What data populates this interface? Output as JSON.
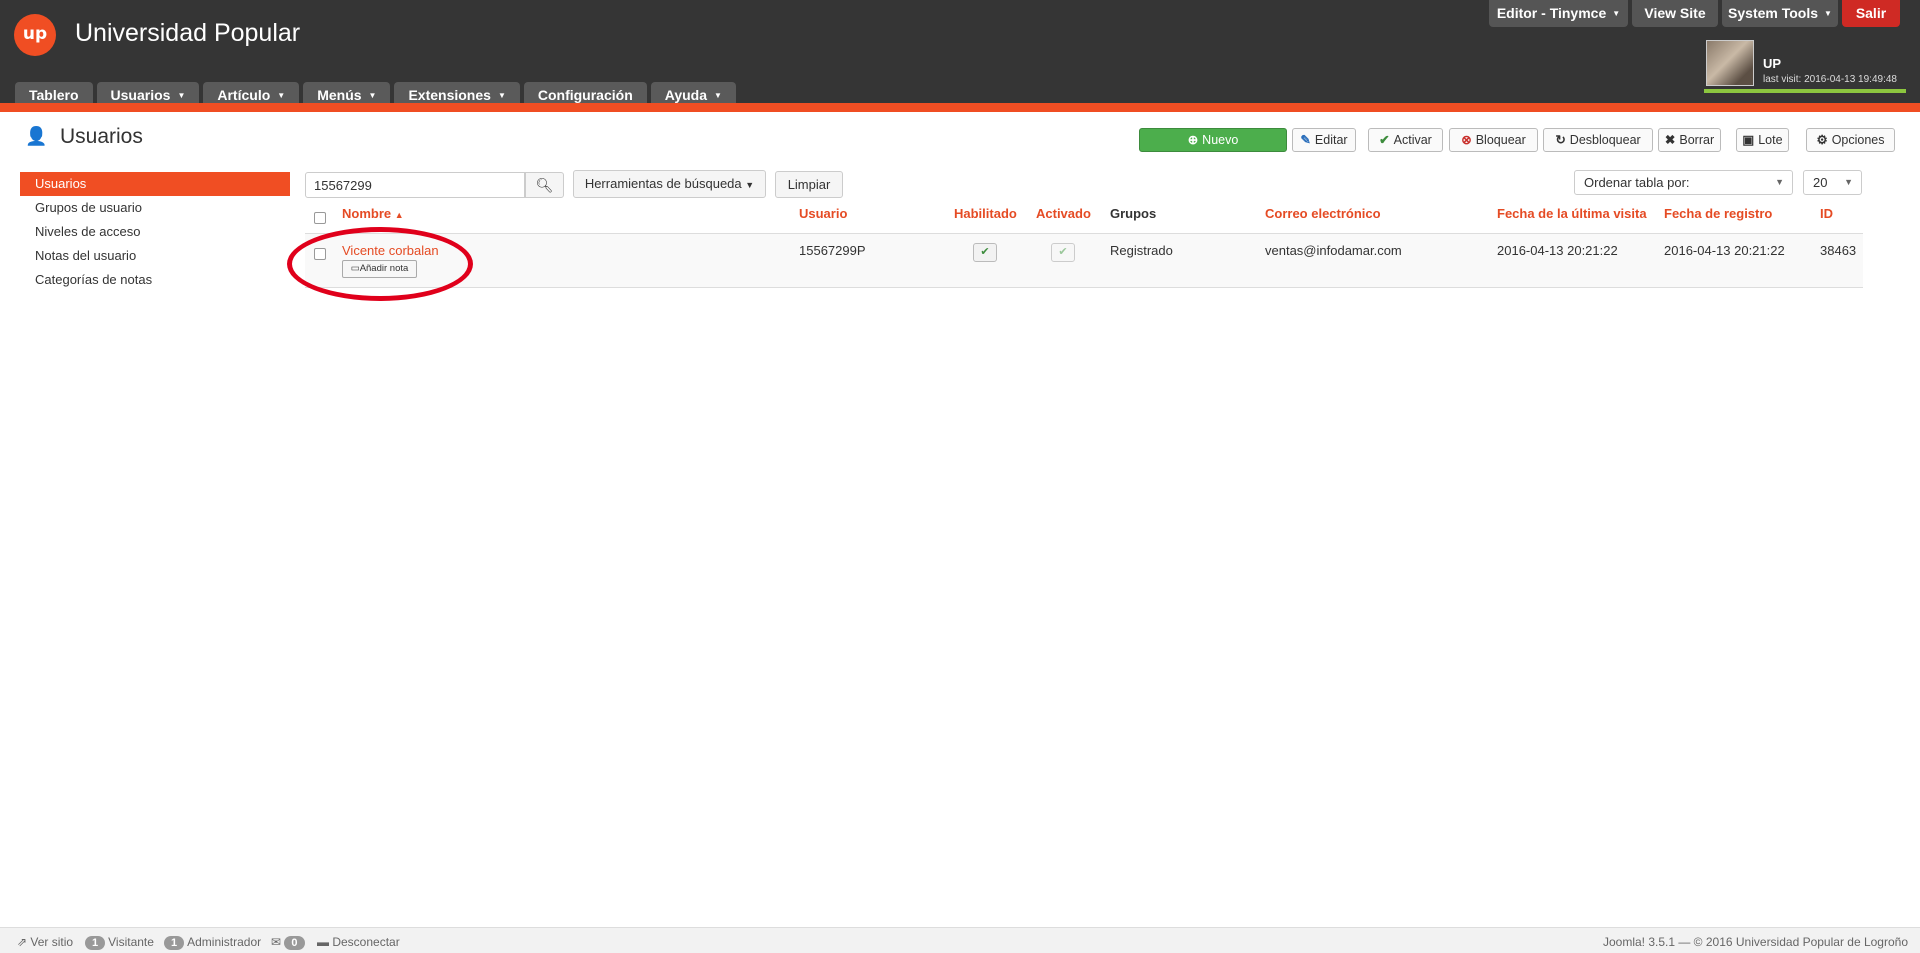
{
  "header": {
    "logo_text": "up",
    "site_title": "Universidad Popular",
    "top_buttons": {
      "editor": "Editor - Tinymce",
      "view_site": "View Site",
      "system_tools": "System Tools",
      "logout": "Salir"
    },
    "user": {
      "name": "UP",
      "last_visit": "last visit: 2016-04-13 19:49:48"
    },
    "accent_color": "#f04e23"
  },
  "nav": {
    "items": [
      {
        "label": "Tablero"
      },
      {
        "label": "Usuarios"
      },
      {
        "label": "Artículo"
      },
      {
        "label": "Menús"
      },
      {
        "label": "Extensiones"
      },
      {
        "label": "Configuración"
      },
      {
        "label": "Ayuda"
      }
    ]
  },
  "page": {
    "title": "Usuarios",
    "icon": "users-icon"
  },
  "toolbar": {
    "new": "Nuevo",
    "edit": "Editar",
    "activate": "Activar",
    "block": "Bloquear",
    "unblock": "Desbloquear",
    "delete": "Borrar",
    "batch": "Lote",
    "options": "Opciones"
  },
  "sidebar": {
    "items": [
      {
        "label": "Usuarios",
        "active": true
      },
      {
        "label": "Grupos de usuario"
      },
      {
        "label": "Niveles de acceso"
      },
      {
        "label": "Notas del usuario"
      },
      {
        "label": "Categorías de notas"
      }
    ]
  },
  "filters": {
    "search_value": "15567299",
    "search_tools": "Herramientas de búsqueda",
    "clear": "Limpiar",
    "order_by": "Ordenar tabla por:",
    "limit": "20"
  },
  "table": {
    "headers": {
      "name": "Nombre",
      "username": "Usuario",
      "enabled": "Habilitado",
      "activated": "Activado",
      "groups": "Grupos",
      "email": "Correo electrónico",
      "last_visit": "Fecha de la última visita",
      "registered": "Fecha de registro",
      "id": "ID"
    },
    "rows": [
      {
        "name": "Vicente corbalan",
        "add_note": "Añadir nota",
        "username": "15567299P",
        "enabled": true,
        "activated": true,
        "groups": "Registrado",
        "email": "ventas@infodamar.com",
        "last_visit": "2016-04-13 20:21:22",
        "registered": "2016-04-13 20:21:22",
        "id": "38463"
      }
    ]
  },
  "footer": {
    "view_site": "Ver sitio",
    "visitors_count": "1",
    "visitors_label": "Visitante",
    "admins_count": "1",
    "admins_label": "Administrador",
    "messages_count": "0",
    "logout": "Desconectar",
    "copyright": "Joomla! 3.5.1 — © 2016 Universidad Popular de Logroño"
  }
}
